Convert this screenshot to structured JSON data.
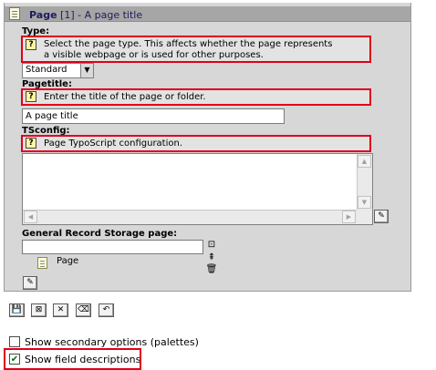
{
  "header": {
    "record_type": "Page",
    "record_uid": "[1]",
    "record_title": "- A page title",
    "icon": "page-icon"
  },
  "fields": {
    "type": {
      "label": "Type:",
      "description_line1": "Select the page type. This affects whether the page represents",
      "description_line2": "a visible webpage or is used for other purposes.",
      "value": "Standard"
    },
    "pagetitle": {
      "label": "Pagetitle:",
      "description": "Enter the title of the page or folder.",
      "value": "A page title"
    },
    "tsconfig": {
      "label": "TSconfig:",
      "description": "Page TypoScript configuration.",
      "value": ""
    },
    "storage": {
      "label": "General Record Storage page:",
      "input_value": "",
      "selected_item": "Page"
    }
  },
  "toolbar": {
    "buttons": [
      "save-icon",
      "save-and-close-icon",
      "close-icon",
      "delete-icon",
      "undo-icon"
    ]
  },
  "options": {
    "secondary": {
      "label": "Show secondary options (palettes)",
      "checked": false
    },
    "descriptions": {
      "label": "Show field descriptions",
      "checked": true
    }
  },
  "colors": {
    "highlight": "#e0001a",
    "header_bg": "#a6a6a6",
    "panel_bg": "#d7d7d7",
    "title_text": "#1c1c60"
  }
}
